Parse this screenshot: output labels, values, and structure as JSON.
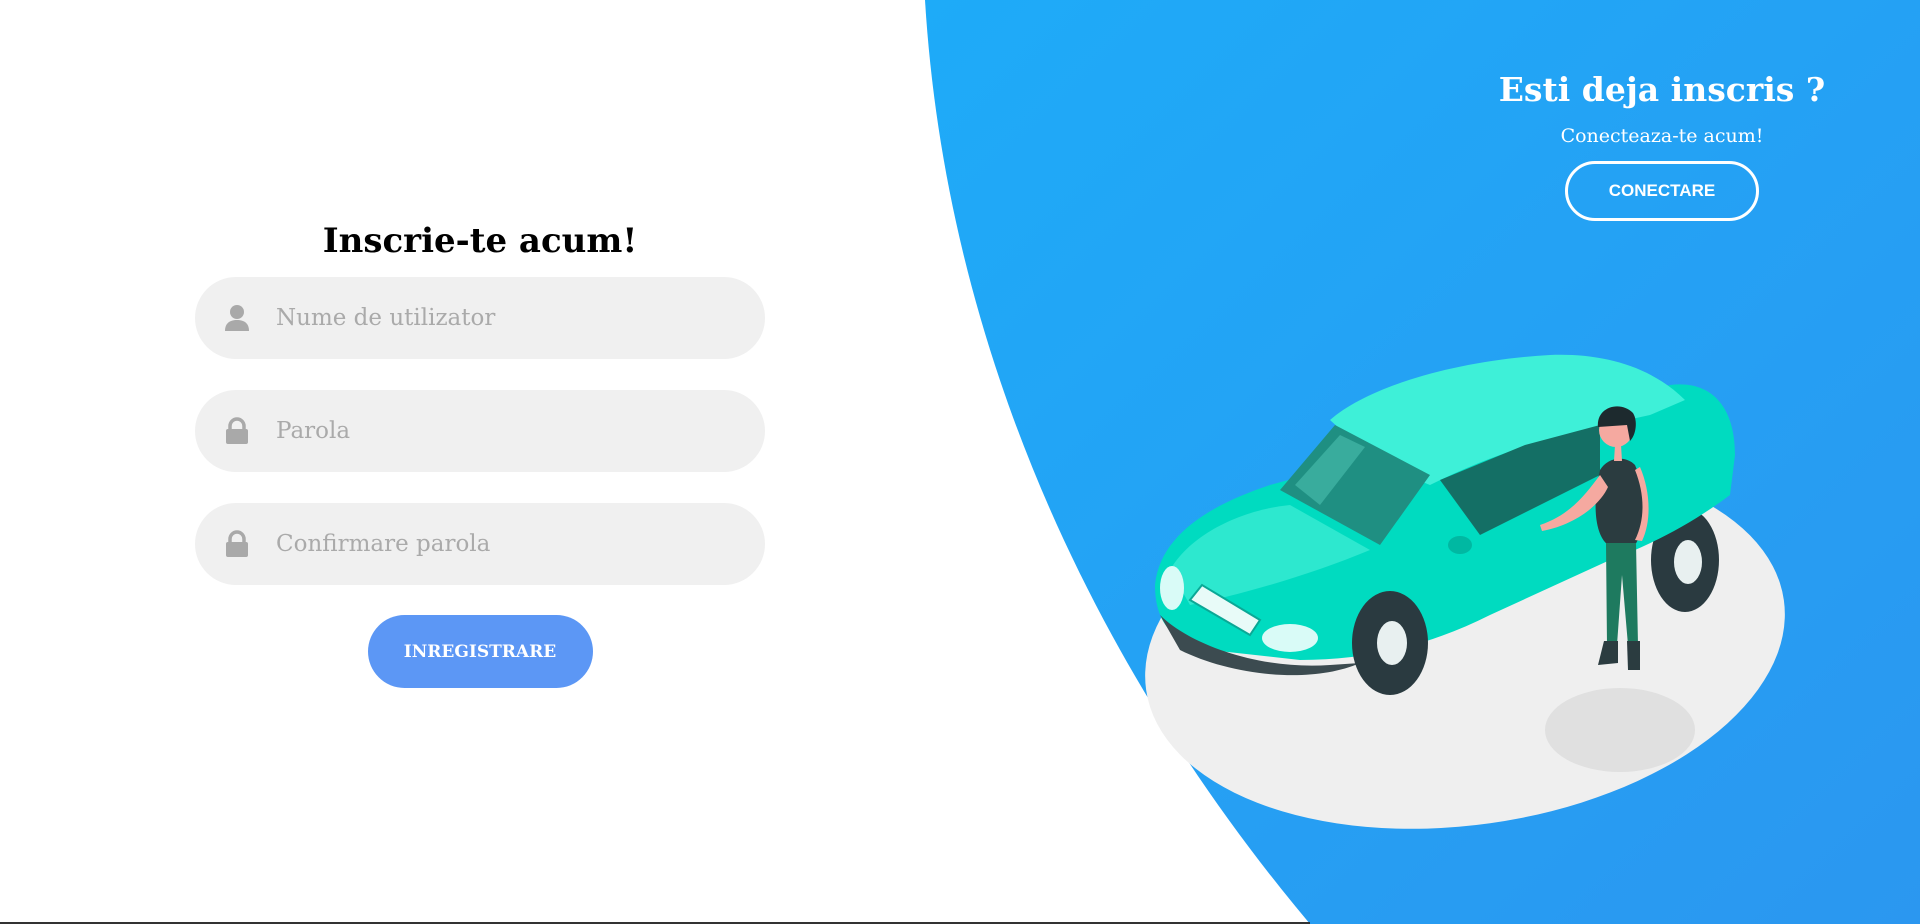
{
  "signup": {
    "title": "Inscrie-te acum!",
    "username_placeholder": "Nume de utilizator",
    "password_placeholder": "Parola",
    "confirm_password_placeholder": "Confirmare parola",
    "register_label": "INREGISTRARE",
    "icons": [
      "user-icon",
      "lock-icon",
      "lock-icon"
    ]
  },
  "login_panel": {
    "title": "Esti deja inscris ?",
    "subtitle": "Conecteaza-te acum!",
    "login_label": "CONECTARE"
  },
  "colors": {
    "panel_blue_start": "#1eabf8",
    "panel_blue_end": "#2b97f0",
    "register_button": "#5c97f5",
    "input_background": "#f0f0f0",
    "car": "#00dbc0"
  }
}
